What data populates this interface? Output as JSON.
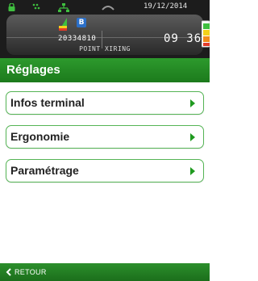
{
  "status": {
    "date": "19/12/2014",
    "time": "09 36",
    "terminal_id": "20334810",
    "shop_name": "POINT XIRING",
    "badge": "B"
  },
  "header": {
    "title": "Réglages"
  },
  "menu": {
    "items": [
      {
        "label": "Infos terminal"
      },
      {
        "label": "Ergonomie"
      },
      {
        "label": "Paramétrage"
      }
    ]
  },
  "footer": {
    "back_label": "RETOUR"
  },
  "colors": {
    "accent_green": "#2d9a2d",
    "border_green": "#55b455",
    "status_bar": "#1c1c1c"
  }
}
